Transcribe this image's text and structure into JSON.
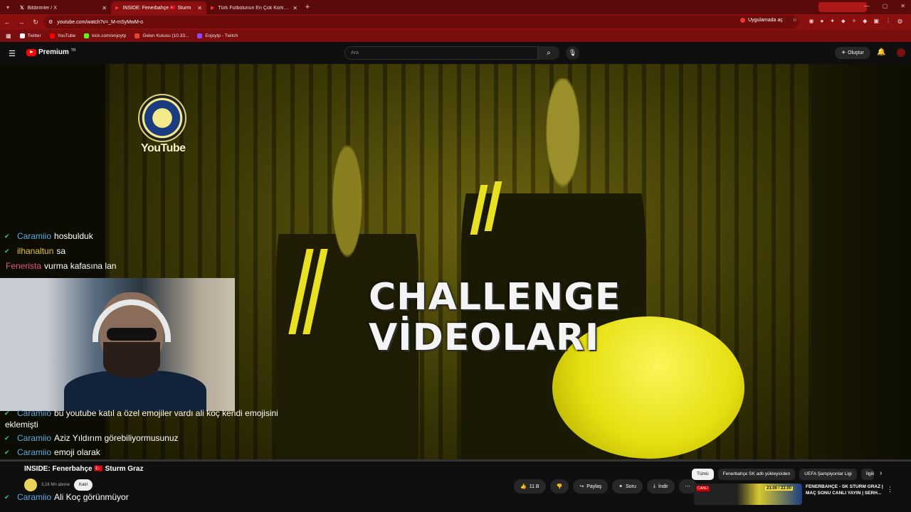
{
  "browser": {
    "tabs": [
      {
        "title": "Bildirimler / X",
        "active": false,
        "icon": "x-logo-icon"
      },
      {
        "title": "INSIDE: Fenerbahçe 🇹🇷 Sturm",
        "active": true,
        "icon": "youtube-icon"
      },
      {
        "title": "Türk Futbolunun En Çok Korku...",
        "active": false,
        "icon": "youtube-icon"
      }
    ],
    "url": "youtube.com/watch?v=_M-mSyMwM-o",
    "open_app_label": "Uygulamada aç",
    "bookmarks": [
      {
        "label": "Twitter",
        "color": "#ffffff"
      },
      {
        "label": "YouTube",
        "color": "#ff0000"
      },
      {
        "label": "kick.com/enjoytp",
        "color": "#53fc18"
      },
      {
        "label": "Gelen Kutusu (10.33...",
        "color": "#ea4335"
      },
      {
        "label": "Enjoytp - Twitch",
        "color": "#9146ff"
      }
    ],
    "accent_color": "#8a1010"
  },
  "youtube": {
    "logo_text": "Premium",
    "region": "TR",
    "search_placeholder": "Ara",
    "create_label": "Oluştur"
  },
  "video": {
    "overlay_line1": "CHALLENGE",
    "overlay_line2": "VİDEOLARI",
    "watermark": "YouTube"
  },
  "chat_top": [
    {
      "user": "Caramiio",
      "msg": "hosbulduk",
      "color": "#5aa9e6"
    },
    {
      "user": "ilhanaltun",
      "msg": "sa",
      "color": "#e8c830"
    },
    {
      "user": "Fenerista",
      "msg": "vurma kafasına lan",
      "color": "#e05a8c"
    }
  ],
  "chat_bottom": [
    {
      "user": "Caramiio",
      "msg": "bu youtube katıl a özel emojiler vardı ali koç kendi emojisini"
    },
    {
      "user": "",
      "msg": "eklemişti"
    },
    {
      "user": "Caramiio",
      "msg": "Aziz Yıldırım görebiliyormusunuz"
    },
    {
      "user": "Caramiio",
      "msg": "emoji olarak"
    },
    {
      "user": "Caramiio",
      "msg": "Ali Koç görünmüyor"
    }
  ],
  "watch": {
    "title": "INSIDE: Fenerbahçe 🇹🇷 Sturm Graz",
    "channel_subs": "3,16 Mn abone",
    "join_label": "Katıl",
    "likes": "11 B",
    "share": "Paylaş",
    "ask": "Soru",
    "download": "İndir"
  },
  "chips": [
    "Tümü",
    "Fenerbahçe SK adlı yükleyiciden",
    "UEFA Şampiyonlar Ligi",
    "İlgili"
  ],
  "recommendation": {
    "live_badge": "CANLI",
    "times": "23.00 / 22.00",
    "title": "FENERBAHÇE - SK STURM GRAZ | MAÇ SONU CANLI YAYIN | SERH..."
  }
}
